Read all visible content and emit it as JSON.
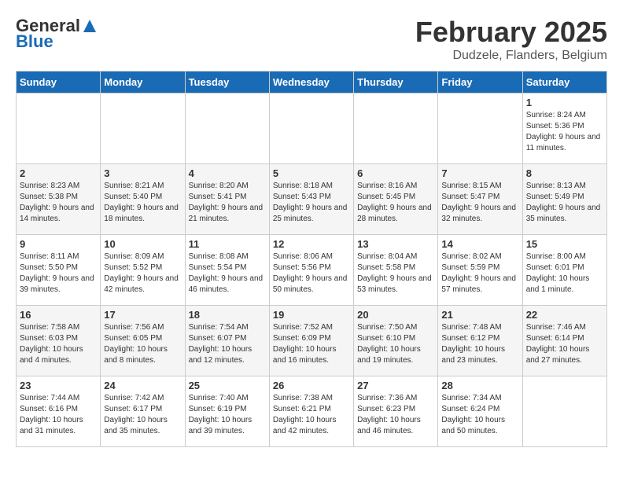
{
  "header": {
    "logo_general": "General",
    "logo_blue": "Blue",
    "month_title": "February 2025",
    "location": "Dudzele, Flanders, Belgium"
  },
  "weekdays": [
    "Sunday",
    "Monday",
    "Tuesday",
    "Wednesday",
    "Thursday",
    "Friday",
    "Saturday"
  ],
  "weeks": [
    [
      {
        "day": "",
        "info": ""
      },
      {
        "day": "",
        "info": ""
      },
      {
        "day": "",
        "info": ""
      },
      {
        "day": "",
        "info": ""
      },
      {
        "day": "",
        "info": ""
      },
      {
        "day": "",
        "info": ""
      },
      {
        "day": "1",
        "info": "Sunrise: 8:24 AM\nSunset: 5:36 PM\nDaylight: 9 hours and 11 minutes."
      }
    ],
    [
      {
        "day": "2",
        "info": "Sunrise: 8:23 AM\nSunset: 5:38 PM\nDaylight: 9 hours and 14 minutes."
      },
      {
        "day": "3",
        "info": "Sunrise: 8:21 AM\nSunset: 5:40 PM\nDaylight: 9 hours and 18 minutes."
      },
      {
        "day": "4",
        "info": "Sunrise: 8:20 AM\nSunset: 5:41 PM\nDaylight: 9 hours and 21 minutes."
      },
      {
        "day": "5",
        "info": "Sunrise: 8:18 AM\nSunset: 5:43 PM\nDaylight: 9 hours and 25 minutes."
      },
      {
        "day": "6",
        "info": "Sunrise: 8:16 AM\nSunset: 5:45 PM\nDaylight: 9 hours and 28 minutes."
      },
      {
        "day": "7",
        "info": "Sunrise: 8:15 AM\nSunset: 5:47 PM\nDaylight: 9 hours and 32 minutes."
      },
      {
        "day": "8",
        "info": "Sunrise: 8:13 AM\nSunset: 5:49 PM\nDaylight: 9 hours and 35 minutes."
      }
    ],
    [
      {
        "day": "9",
        "info": "Sunrise: 8:11 AM\nSunset: 5:50 PM\nDaylight: 9 hours and 39 minutes."
      },
      {
        "day": "10",
        "info": "Sunrise: 8:09 AM\nSunset: 5:52 PM\nDaylight: 9 hours and 42 minutes."
      },
      {
        "day": "11",
        "info": "Sunrise: 8:08 AM\nSunset: 5:54 PM\nDaylight: 9 hours and 46 minutes."
      },
      {
        "day": "12",
        "info": "Sunrise: 8:06 AM\nSunset: 5:56 PM\nDaylight: 9 hours and 50 minutes."
      },
      {
        "day": "13",
        "info": "Sunrise: 8:04 AM\nSunset: 5:58 PM\nDaylight: 9 hours and 53 minutes."
      },
      {
        "day": "14",
        "info": "Sunrise: 8:02 AM\nSunset: 5:59 PM\nDaylight: 9 hours and 57 minutes."
      },
      {
        "day": "15",
        "info": "Sunrise: 8:00 AM\nSunset: 6:01 PM\nDaylight: 10 hours and 1 minute."
      }
    ],
    [
      {
        "day": "16",
        "info": "Sunrise: 7:58 AM\nSunset: 6:03 PM\nDaylight: 10 hours and 4 minutes."
      },
      {
        "day": "17",
        "info": "Sunrise: 7:56 AM\nSunset: 6:05 PM\nDaylight: 10 hours and 8 minutes."
      },
      {
        "day": "18",
        "info": "Sunrise: 7:54 AM\nSunset: 6:07 PM\nDaylight: 10 hours and 12 minutes."
      },
      {
        "day": "19",
        "info": "Sunrise: 7:52 AM\nSunset: 6:09 PM\nDaylight: 10 hours and 16 minutes."
      },
      {
        "day": "20",
        "info": "Sunrise: 7:50 AM\nSunset: 6:10 PM\nDaylight: 10 hours and 19 minutes."
      },
      {
        "day": "21",
        "info": "Sunrise: 7:48 AM\nSunset: 6:12 PM\nDaylight: 10 hours and 23 minutes."
      },
      {
        "day": "22",
        "info": "Sunrise: 7:46 AM\nSunset: 6:14 PM\nDaylight: 10 hours and 27 minutes."
      }
    ],
    [
      {
        "day": "23",
        "info": "Sunrise: 7:44 AM\nSunset: 6:16 PM\nDaylight: 10 hours and 31 minutes."
      },
      {
        "day": "24",
        "info": "Sunrise: 7:42 AM\nSunset: 6:17 PM\nDaylight: 10 hours and 35 minutes."
      },
      {
        "day": "25",
        "info": "Sunrise: 7:40 AM\nSunset: 6:19 PM\nDaylight: 10 hours and 39 minutes."
      },
      {
        "day": "26",
        "info": "Sunrise: 7:38 AM\nSunset: 6:21 PM\nDaylight: 10 hours and 42 minutes."
      },
      {
        "day": "27",
        "info": "Sunrise: 7:36 AM\nSunset: 6:23 PM\nDaylight: 10 hours and 46 minutes."
      },
      {
        "day": "28",
        "info": "Sunrise: 7:34 AM\nSunset: 6:24 PM\nDaylight: 10 hours and 50 minutes."
      },
      {
        "day": "",
        "info": ""
      }
    ]
  ]
}
